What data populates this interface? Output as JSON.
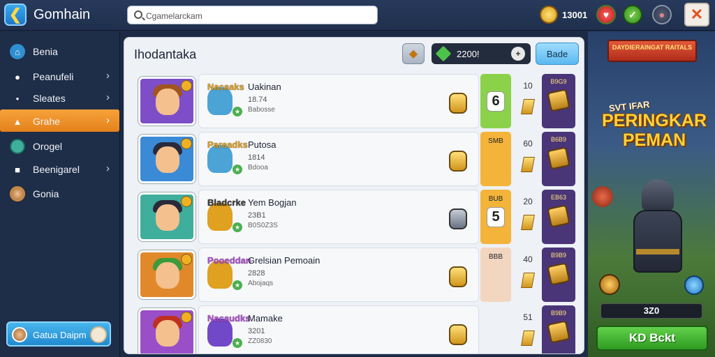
{
  "app": {
    "title": "Gomhain"
  },
  "search": {
    "placeholder": "Cgamelarckam"
  },
  "topbar": {
    "coins": "13001"
  },
  "sidebar": {
    "items": [
      {
        "label": "Benia",
        "icon": "home-icon",
        "chevron": false,
        "active": false
      },
      {
        "label": "Peanufeli",
        "icon": "bulb-icon",
        "chevron": true,
        "active": false
      },
      {
        "label": "Sleates",
        "icon": "dot-icon",
        "chevron": true,
        "active": false
      },
      {
        "label": "Grahe",
        "icon": "trophy-icon",
        "chevron": true,
        "active": true
      },
      {
        "label": "Orogel",
        "icon": "profile-icon",
        "chevron": false,
        "active": false
      },
      {
        "label": "Beenigarel",
        "icon": "gamepad-icon",
        "chevron": true,
        "active": false
      },
      {
        "label": "Gonia",
        "icon": "avatar-icon",
        "chevron": false,
        "active": false
      }
    ],
    "bottom_button": "Gatua Daipm"
  },
  "panel": {
    "title": "Ihodantaka",
    "gem_value": "2200!",
    "blue_button": "Bade"
  },
  "rows": [
    {
      "tag": "Nacaaks",
      "name": "Uakinan",
      "stat1": "18.74",
      "stat2": "Babosse",
      "score": "6",
      "score_top": "",
      "col2": "10",
      "col3": "B9G9",
      "tag_color": "#e0a020",
      "hair": "#a0541e",
      "avatar_bg": "#7d4ec8",
      "mini_color": "#4ba3d6",
      "score_color": "#8bd24a",
      "item_grey": false
    },
    {
      "tag": "Pareadks",
      "name": "Putosa",
      "stat1": "1814",
      "stat2": "Bdooa",
      "score": "",
      "score_top": "SMB",
      "col2": "60",
      "col3": "B6B9",
      "tag_color": "#e0a020",
      "hair": "#2a2a3a",
      "avatar_bg": "#3b8ad6",
      "mini_color": "#4ba3d6",
      "score_color": "#f4b43a",
      "item_grey": false
    },
    {
      "tag": "Bladcrke",
      "name": "Yem Bogjan",
      "stat1": "23B1",
      "stat2": "B0S0Z3S",
      "score": "5",
      "score_top": "BUB",
      "col2": "20",
      "col3": "EB63",
      "tag_color": "#3a3a3a",
      "hair": "#2a2a3a",
      "avatar_bg": "#3fae9c",
      "mini_color": "#e0a020",
      "score_color": "#f4b43a",
      "item_grey": true
    },
    {
      "tag": "Pooeddan",
      "name": "Grelsian Pemoain",
      "stat1": "2828",
      "stat2": "Abojaqs",
      "score": "",
      "score_top": "BBB",
      "col2": "40",
      "col3": "B9B9",
      "tag_color": "#b050d0",
      "hair": "#3c9a3a",
      "avatar_bg": "#e0882a",
      "mini_color": "#e0a020",
      "score_color": "#f2d6c0",
      "item_grey": false
    },
    {
      "tag": "Nacaudks",
      "name": "Mamake",
      "stat1": "3201",
      "stat2": "ZZ0830",
      "score": "",
      "score_top": "",
      "col2": "51",
      "col3": "B9B9",
      "tag_color": "#b050d0",
      "hair": "#c03020",
      "avatar_bg": "#9a4ec8",
      "mini_color": "#7048c8",
      "score_color": "#eef1f6",
      "item_grey": false
    }
  ],
  "banner": {
    "ribbon": "DAYDIERAINGAT RAITALS",
    "subtitle": "SVT IFAR",
    "title": "PERINGKAR PEMAN",
    "score": "3Z0",
    "button": "KD Bckt"
  },
  "colors": {
    "accent": "#f39a2c",
    "top_bar": "#263857",
    "panel": "#eef1f6"
  }
}
